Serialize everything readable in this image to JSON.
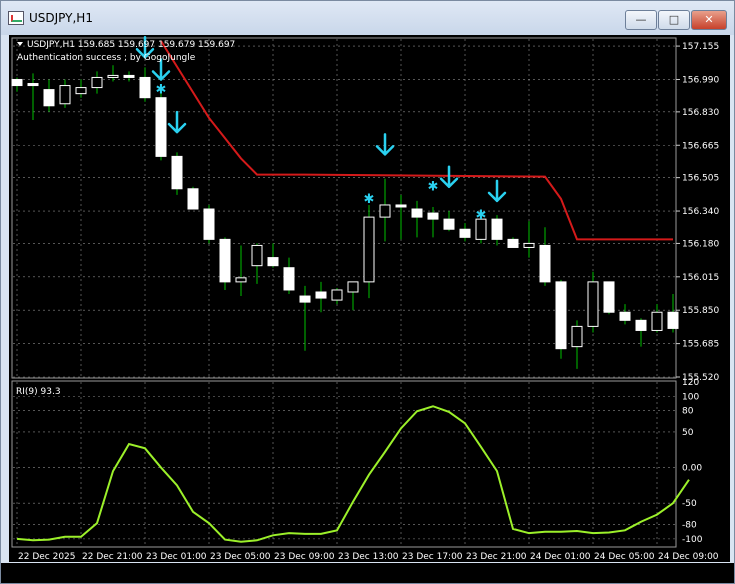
{
  "window": {
    "title": "USDJPY,H1",
    "buttons": {
      "minimize": "—",
      "maximize": "□",
      "close": "✕"
    }
  },
  "chart": {
    "info_line": "USDJPY,H1  159.685 159.697 159.679 159.697",
    "annotation": "Authentication success ; by GogoJungle",
    "price_ticks": [
      "157.155",
      "156.990",
      "156.830",
      "156.665",
      "156.505",
      "156.340",
      "156.180",
      "156.015",
      "155.850",
      "155.685",
      "155.520"
    ],
    "indicator_label": "RI(9) 93.3",
    "indicator_ticks": [
      "120",
      "100",
      "80",
      "50",
      "0.00",
      "-50",
      "-80",
      "-100"
    ],
    "time_ticks": [
      "22 Dec 2025",
      "22 Dec 21:00",
      "23 Dec 01:00",
      "23 Dec 05:00",
      "23 Dec 09:00",
      "23 Dec 13:00",
      "23 Dec 17:00",
      "23 Dec 21:00",
      "24 Dec 01:00",
      "24 Dec 05:00",
      "24 Dec 09:00"
    ]
  },
  "colors": {
    "background": "#000000",
    "bull_candle": "#ffffff",
    "bear_candle": "#ffffff",
    "wick": "#00c000",
    "trend_line": "#d41a1a",
    "signal_arrow": "#2ad1f0",
    "indicator_line": "#9cf02a",
    "grid": "#8a8a8a"
  },
  "icons": {
    "arrow": "down-arrow-icon",
    "star": "star-icon"
  },
  "chart_data": [
    {
      "type": "candlestick",
      "title": "USDJPY,H1",
      "ylim": [
        155.52,
        157.19
      ],
      "candles": [
        {
          "o": 156.99,
          "h": 157.0,
          "l": 156.93,
          "c": 156.96
        },
        {
          "o": 156.97,
          "h": 157.02,
          "l": 156.79,
          "c": 156.96
        },
        {
          "o": 156.94,
          "h": 156.99,
          "l": 156.83,
          "c": 156.86
        },
        {
          "o": 156.87,
          "h": 156.99,
          "l": 156.85,
          "c": 156.96
        },
        {
          "o": 156.92,
          "h": 156.99,
          "l": 156.9,
          "c": 156.95
        },
        {
          "o": 156.95,
          "h": 157.03,
          "l": 156.92,
          "c": 157.0
        },
        {
          "o": 157.0,
          "h": 157.06,
          "l": 156.98,
          "c": 157.01
        },
        {
          "o": 157.01,
          "h": 157.03,
          "l": 156.98,
          "c": 157.0
        },
        {
          "o": 157.0,
          "h": 157.05,
          "l": 156.88,
          "c": 156.9
        },
        {
          "o": 156.9,
          "h": 156.94,
          "l": 156.59,
          "c": 156.61
        },
        {
          "o": 156.61,
          "h": 156.63,
          "l": 156.42,
          "c": 156.45
        },
        {
          "o": 156.45,
          "h": 156.46,
          "l": 156.35,
          "c": 156.35
        },
        {
          "o": 156.35,
          "h": 156.37,
          "l": 156.18,
          "c": 156.2
        },
        {
          "o": 156.2,
          "h": 156.21,
          "l": 155.95,
          "c": 155.99
        },
        {
          "o": 155.99,
          "h": 156.17,
          "l": 155.92,
          "c": 156.01
        },
        {
          "o": 156.07,
          "h": 156.18,
          "l": 155.98,
          "c": 156.17
        },
        {
          "o": 156.11,
          "h": 156.18,
          "l": 156.06,
          "c": 156.07
        },
        {
          "o": 156.06,
          "h": 156.11,
          "l": 155.93,
          "c": 155.95
        },
        {
          "o": 155.92,
          "h": 155.97,
          "l": 155.65,
          "c": 155.89
        },
        {
          "o": 155.94,
          "h": 155.99,
          "l": 155.84,
          "c": 155.91
        },
        {
          "o": 155.9,
          "h": 155.96,
          "l": 155.88,
          "c": 155.95
        },
        {
          "o": 155.94,
          "h": 155.99,
          "l": 155.85,
          "c": 155.99
        },
        {
          "o": 155.99,
          "h": 156.37,
          "l": 155.91,
          "c": 156.31
        },
        {
          "o": 156.31,
          "h": 156.5,
          "l": 156.19,
          "c": 156.37
        },
        {
          "o": 156.37,
          "h": 156.42,
          "l": 156.2,
          "c": 156.36
        },
        {
          "o": 156.35,
          "h": 156.39,
          "l": 156.21,
          "c": 156.31
        },
        {
          "o": 156.33,
          "h": 156.36,
          "l": 156.21,
          "c": 156.3
        },
        {
          "o": 156.3,
          "h": 156.34,
          "l": 156.24,
          "c": 156.25
        },
        {
          "o": 156.25,
          "h": 156.28,
          "l": 156.19,
          "c": 156.21
        },
        {
          "o": 156.2,
          "h": 156.33,
          "l": 156.18,
          "c": 156.3
        },
        {
          "o": 156.3,
          "h": 156.32,
          "l": 156.17,
          "c": 156.2
        },
        {
          "o": 156.2,
          "h": 156.21,
          "l": 156.16,
          "c": 156.16
        },
        {
          "o": 156.16,
          "h": 156.29,
          "l": 156.11,
          "c": 156.18
        },
        {
          "o": 156.17,
          "h": 156.26,
          "l": 155.97,
          "c": 155.99
        },
        {
          "o": 155.99,
          "h": 156.0,
          "l": 155.61,
          "c": 155.66
        },
        {
          "o": 155.67,
          "h": 155.8,
          "l": 155.56,
          "c": 155.77
        },
        {
          "o": 155.77,
          "h": 156.04,
          "l": 155.74,
          "c": 155.99
        },
        {
          "o": 155.99,
          "h": 155.99,
          "l": 155.83,
          "c": 155.84
        },
        {
          "o": 155.84,
          "h": 155.88,
          "l": 155.78,
          "c": 155.8
        },
        {
          "o": 155.8,
          "h": 155.81,
          "l": 155.67,
          "c": 155.75
        },
        {
          "o": 155.75,
          "h": 155.88,
          "l": 155.74,
          "c": 155.84
        },
        {
          "o": 155.84,
          "h": 155.93,
          "l": 155.74,
          "c": 155.76
        }
      ],
      "trend_line": [
        {
          "i": 9,
          "v": 157.18
        },
        {
          "i": 12,
          "v": 156.8
        },
        {
          "i": 14,
          "v": 156.6
        },
        {
          "i": 15,
          "v": 156.52
        },
        {
          "i": 18,
          "v": 156.52
        },
        {
          "i": 33,
          "v": 156.51
        },
        {
          "i": 34,
          "v": 156.4
        },
        {
          "i": 35,
          "v": 156.2
        },
        {
          "i": 41,
          "v": 156.2
        }
      ],
      "signals": [
        {
          "i": 8,
          "type": "arrow",
          "v": 157.1
        },
        {
          "i": 9,
          "type": "arrow",
          "v": 156.99
        },
        {
          "i": 9,
          "type": "star",
          "v": 156.94
        },
        {
          "i": 10,
          "type": "arrow",
          "v": 156.73
        },
        {
          "i": 22,
          "type": "star",
          "v": 156.4
        },
        {
          "i": 23,
          "type": "arrow",
          "v": 156.62
        },
        {
          "i": 26,
          "type": "star",
          "v": 156.46
        },
        {
          "i": 27,
          "type": "arrow",
          "v": 156.46
        },
        {
          "i": 29,
          "type": "star",
          "v": 156.32
        },
        {
          "i": 30,
          "type": "arrow",
          "v": 156.39
        }
      ]
    },
    {
      "type": "line",
      "title": "RI(9) 93.3",
      "ylim": [
        -110,
        120
      ],
      "series": [
        {
          "values": [
            -100,
            -102,
            -101,
            -97,
            -97,
            -78,
            -5,
            33,
            27,
            0,
            -25,
            -62,
            -78,
            -101,
            -104,
            -102,
            -95,
            -92,
            -93,
            -93,
            -88,
            -48,
            -10,
            22,
            55,
            79,
            86,
            78,
            62,
            29,
            -5,
            -86,
            -92,
            -90,
            -90,
            -89,
            -92,
            -91,
            -88,
            -76,
            -66,
            -50,
            -17
          ]
        }
      ]
    }
  ]
}
